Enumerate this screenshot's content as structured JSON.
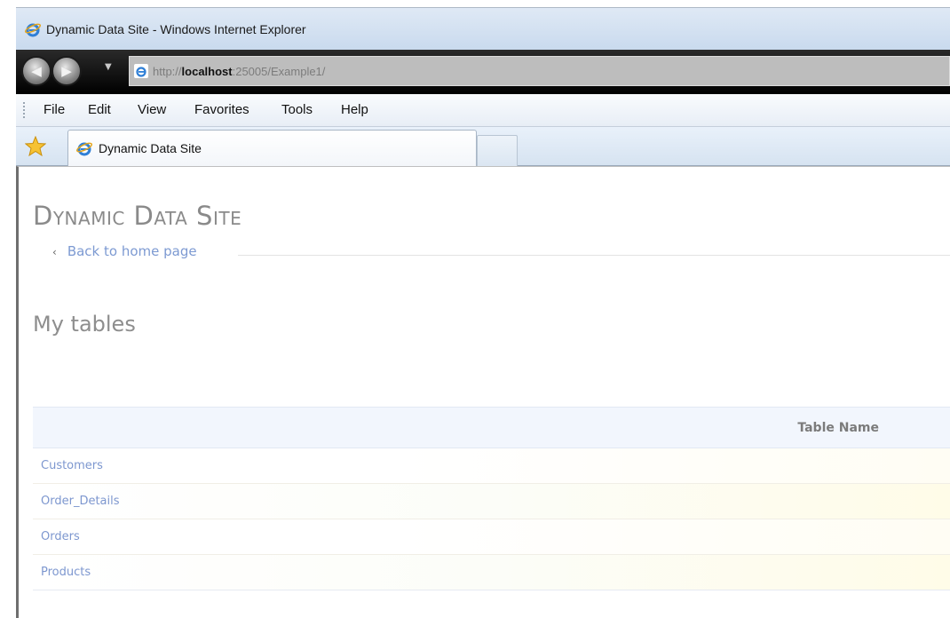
{
  "window": {
    "title": "Dynamic Data Site - Windows Internet Explorer"
  },
  "navigation": {
    "back_icon": "back-arrow-icon",
    "forward_icon": "forward-arrow-icon",
    "url_prefix": "http://",
    "url_host": "localhost",
    "url_rest": ":25005/Example1/"
  },
  "menu": {
    "items": [
      "File",
      "Edit",
      "View",
      "Favorites",
      "Tools",
      "Help"
    ]
  },
  "tabs": {
    "favorites_icon": "favorites-star-icon",
    "active_tab_label": "Dynamic Data Site"
  },
  "page": {
    "site_title": "Dynamic Data Site",
    "back_link": "Back to home page",
    "section_heading": "My tables",
    "table": {
      "column_header": "Table Name",
      "rows": [
        "Customers",
        "Order_Details",
        "Orders",
        "Products"
      ]
    }
  },
  "colors": {
    "link": "#7d9ad2",
    "header_bg": "#f2f6fd",
    "title_gray": "#8a8a8a"
  }
}
